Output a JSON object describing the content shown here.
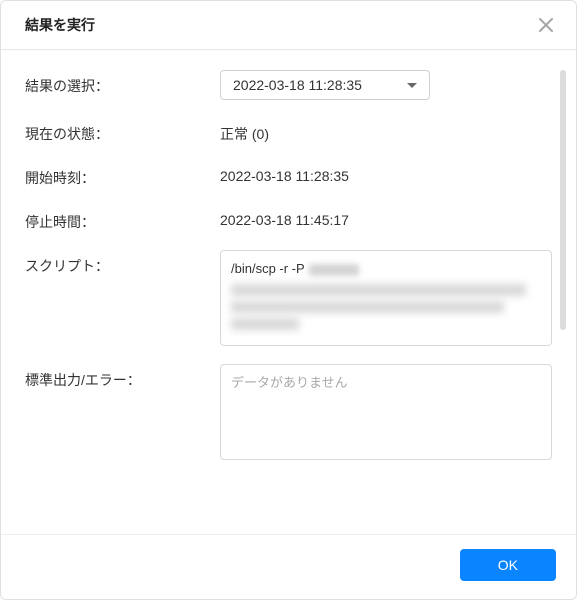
{
  "header": {
    "title": "結果を実行"
  },
  "form": {
    "select_result_label": "結果の選択：",
    "select_result_value": "2022-03-18 11:28:35",
    "status_label": "現在の状態：",
    "status_value": "正常 (0)",
    "start_time_label": "開始時刻：",
    "start_time_value": "2022-03-18 11:28:35",
    "stop_time_label": "停止時間：",
    "stop_time_value": "2022-03-18 11:45:17",
    "script_label": "スクリプト：",
    "script_visible_prefix": "/bin/scp -r -P",
    "output_label": "標準出力/エラー：",
    "output_placeholder": "データがありません"
  },
  "footer": {
    "ok_label": "OK"
  }
}
